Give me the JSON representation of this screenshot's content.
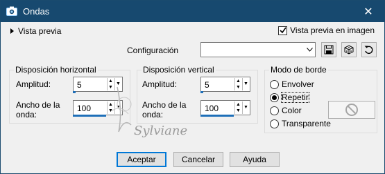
{
  "window": {
    "title": "Ondas",
    "close_glyph": "✕"
  },
  "preview": {
    "toggle_label": "Vista previa",
    "checkbox_label": "Vista previa en imagen",
    "checked": true
  },
  "config": {
    "label": "Configuración",
    "value": "",
    "icons": [
      "save-icon",
      "dice-icon",
      "reset-icon"
    ]
  },
  "horizontal": {
    "legend": "Disposición horizontal",
    "amplitude_label": "Amplitud:",
    "amplitude_value": "5",
    "wavelength_label_1": "Ancho de la",
    "wavelength_label_2": "onda:",
    "wavelength_value": "100"
  },
  "vertical": {
    "legend": "Disposición vertical",
    "amplitude_label": "Amplitud:",
    "amplitude_value": "5",
    "wavelength_label_1": "Ancho de la",
    "wavelength_label_2": "onda:",
    "wavelength_value": "100"
  },
  "edge_mode": {
    "legend": "Modo de borde",
    "options": [
      {
        "label": "Envolver",
        "selected": false
      },
      {
        "label": "Repetir",
        "selected": true
      },
      {
        "label": "Color",
        "selected": false
      },
      {
        "label": "Transparente",
        "selected": false
      }
    ]
  },
  "watermark": {
    "text": "Sylviane"
  },
  "buttons": {
    "ok": "Aceptar",
    "cancel": "Cancelar",
    "help": "Ayuda"
  },
  "colors": {
    "titlebar": "#17496f",
    "slider": "#1e6fb8",
    "focus": "#0078d7"
  }
}
